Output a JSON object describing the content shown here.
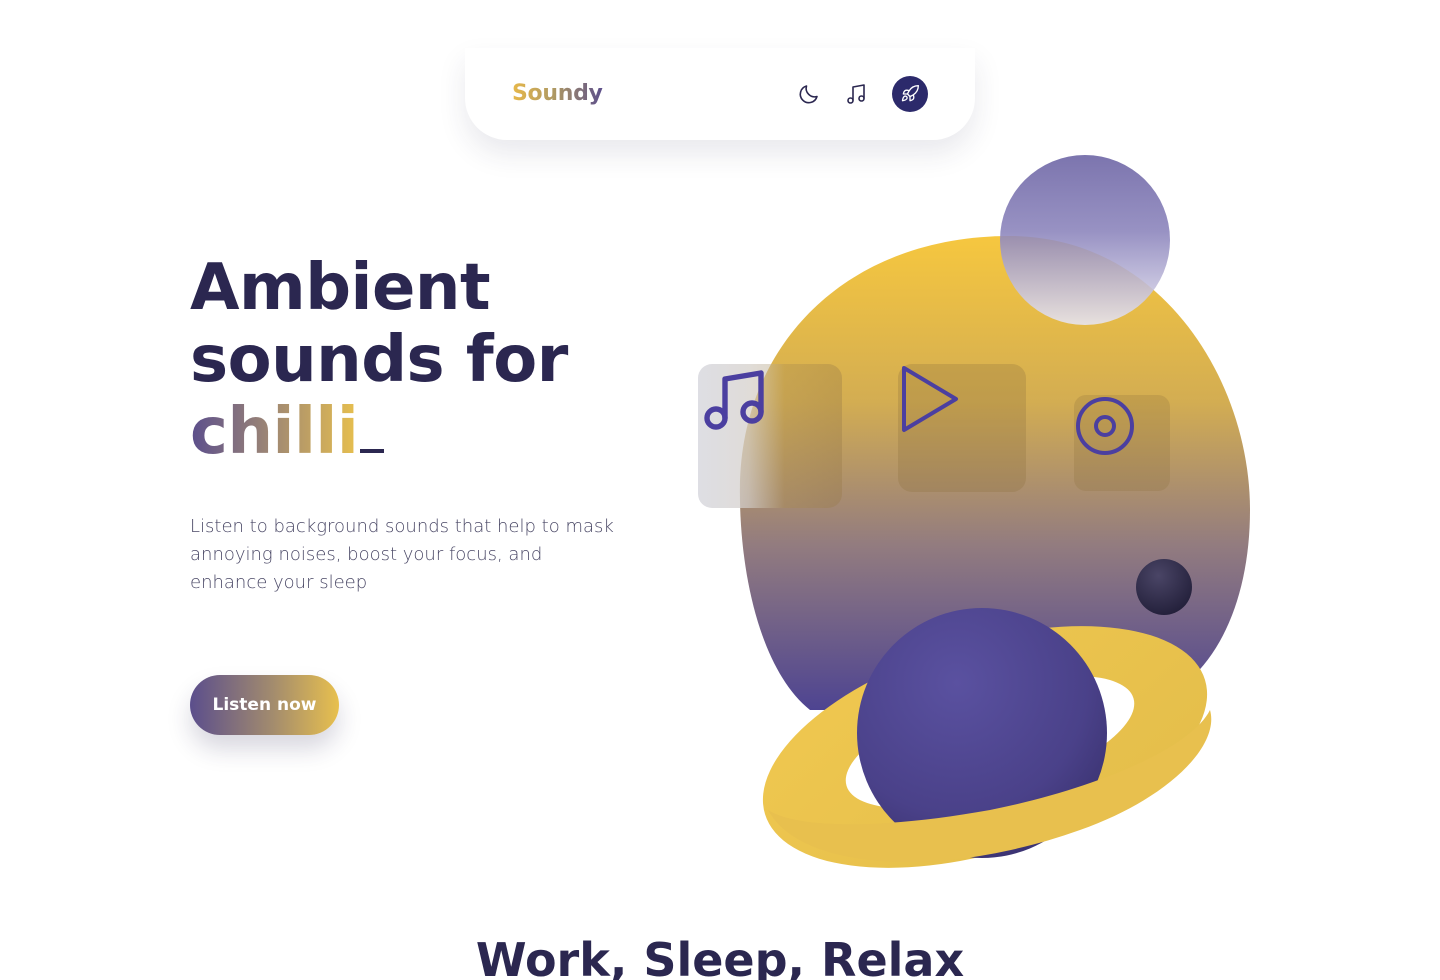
{
  "nav": {
    "brand": "Soundy",
    "icons": [
      "moon-icon",
      "music-note-icon",
      "rocket-icon"
    ]
  },
  "hero": {
    "title_line1": "Ambient",
    "title_line2": "sounds for",
    "typed_word": "chilli",
    "description": "Listen to background sounds that help to mask annoying noises, boost your focus, and enhance your sleep",
    "cta_label": "Listen now"
  },
  "art": {
    "cards": [
      "music-note-icon",
      "play-icon",
      "disc-icon"
    ]
  },
  "section": {
    "title": "Work, Sleep, Relax"
  },
  "colors": {
    "navy": "#2b2750",
    "purple": "#5b4e8c",
    "gold": "#e8c04e",
    "rocket_bg": "#2c2a6b"
  }
}
